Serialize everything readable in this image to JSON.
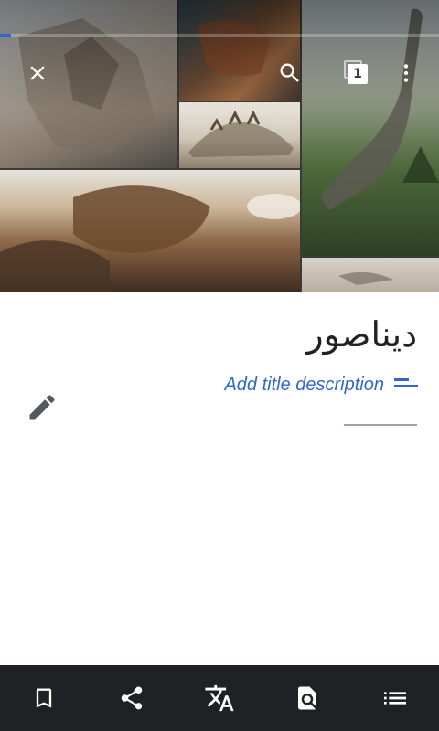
{
  "hero": {
    "images": [
      {
        "name": "triceratops-skeleton-photo"
      },
      {
        "name": "theropod-model-photo"
      },
      {
        "name": "stegosaurus-skeleton-photo"
      },
      {
        "name": "tyrannosaurus-skull-photo"
      },
      {
        "name": "brachiosaurus-sculpture-photo"
      },
      {
        "name": "fossil-display-photo"
      }
    ],
    "load_progress": 0.025
  },
  "toolbar": {
    "close_icon": "close-icon",
    "search_icon": "search-icon",
    "tab_count": "1",
    "menu_icon": "more-vert-icon"
  },
  "article": {
    "title": "دیناصور",
    "description_prompt": "Add title description"
  },
  "bottom_bar": {
    "items": [
      {
        "icon": "bookmark-icon"
      },
      {
        "icon": "share-icon"
      },
      {
        "icon": "translate-icon"
      },
      {
        "icon": "find-in-page-icon"
      },
      {
        "icon": "contents-list-icon"
      }
    ]
  },
  "colors": {
    "accent": "#3366cc",
    "bottom_bar_bg": "#1f2124",
    "title_text": "#202122"
  }
}
